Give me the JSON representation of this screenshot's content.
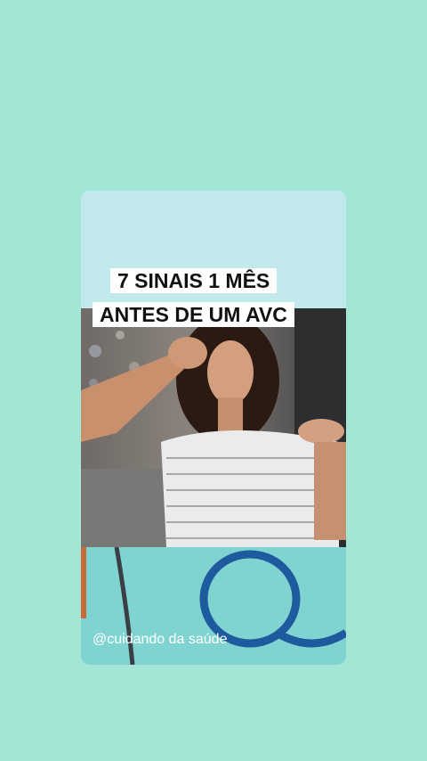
{
  "post": {
    "title_line1": "7 SINAIS 1 MÊS",
    "title_line2": "ANTES DE UM AVC",
    "watermark": "@cuidando da saúde"
  },
  "colors": {
    "page_background": "#a4e6d5",
    "card_top": "#c2eaec",
    "card_bottom": "#7fd4d1"
  }
}
